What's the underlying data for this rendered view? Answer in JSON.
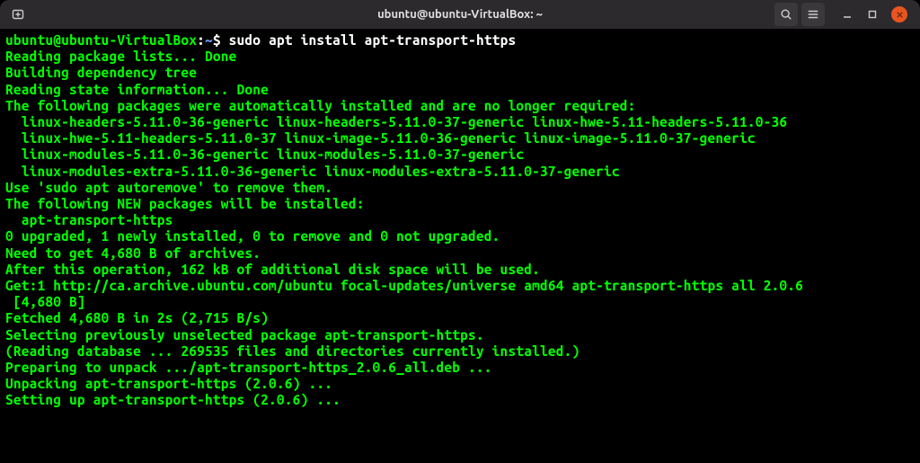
{
  "window": {
    "title": "ubuntu@ubuntu-VirtualBox: ~"
  },
  "prompt": {
    "userhost": "ubuntu@ubuntu-VirtualBox",
    "colon": ":",
    "path": "~",
    "dollar": "$ "
  },
  "command": "sudo apt install apt-transport-https",
  "output": {
    "l1": "Reading package lists... Done",
    "l2": "Building dependency tree",
    "l3": "Reading state information... Done",
    "l4": "The following packages were automatically installed and are no longer required:",
    "l5": "  linux-headers-5.11.0-36-generic linux-headers-5.11.0-37-generic linux-hwe-5.11-headers-5.11.0-36",
    "l6": "  linux-hwe-5.11-headers-5.11.0-37 linux-image-5.11.0-36-generic linux-image-5.11.0-37-generic",
    "l7": "  linux-modules-5.11.0-36-generic linux-modules-5.11.0-37-generic",
    "l8": "  linux-modules-extra-5.11.0-36-generic linux-modules-extra-5.11.0-37-generic",
    "l9": "Use 'sudo apt autoremove' to remove them.",
    "l10": "The following NEW packages will be installed:",
    "l11": "  apt-transport-https",
    "l12": "0 upgraded, 1 newly installed, 0 to remove and 0 not upgraded.",
    "l13": "Need to get 4,680 B of archives.",
    "l14": "After this operation, 162 kB of additional disk space will be used.",
    "l15": "Get:1 http://ca.archive.ubuntu.com/ubuntu focal-updates/universe amd64 apt-transport-https all 2.0.6",
    "l15b": " [4,680 B]",
    "l16": "Fetched 4,680 B in 2s (2,715 B/s)",
    "l17": "Selecting previously unselected package apt-transport-https.",
    "l18": "(Reading database ... 269535 files and directories currently installed.)",
    "l19": "Preparing to unpack .../apt-transport-https_2.0.6_all.deb ...",
    "l20": "Unpacking apt-transport-https (2.0.6) ...",
    "l21": "Setting up apt-transport-https (2.0.6) ..."
  }
}
